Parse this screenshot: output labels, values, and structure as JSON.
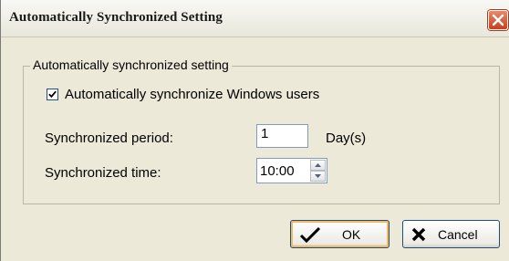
{
  "window": {
    "title": "Automatically Synchronized Setting"
  },
  "group": {
    "legend": "Automatically synchronized setting",
    "sync_checkbox": {
      "label": "Automatically synchronize Windows users",
      "checked": true
    },
    "period": {
      "label": "Synchronized period:",
      "value": "1",
      "unit": "Day(s)"
    },
    "time": {
      "label": "Synchronized time:",
      "value": "10:00"
    }
  },
  "buttons": {
    "ok_label": "OK",
    "cancel_label": "Cancel"
  },
  "icons": {
    "close": "close-icon",
    "ok": "checkmark-icon",
    "cancel": "x-icon",
    "spin_up": "arrow-up-icon",
    "spin_down": "arrow-down-icon"
  },
  "colors": {
    "dialog_bg": "#ece9d8",
    "close_button": "#c4401f",
    "default_button_focus": "#f4b95d"
  }
}
